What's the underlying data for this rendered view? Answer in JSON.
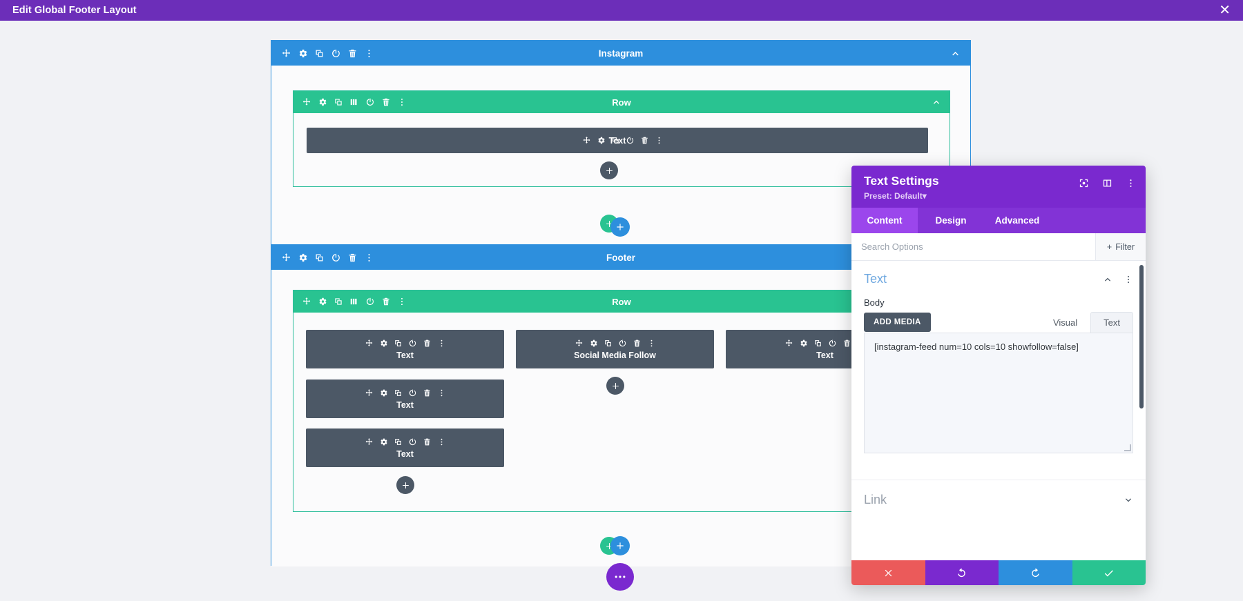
{
  "topbar": {
    "title": "Edit Global Footer Layout",
    "close_label": "✕"
  },
  "canvas": {
    "sections": [
      {
        "name": "Instagram",
        "title": "Instagram",
        "rows": [
          {
            "title": "Row",
            "modules": [
              {
                "label": "Text"
              }
            ]
          }
        ]
      },
      {
        "name": "Footer",
        "title": "Footer",
        "rows": [
          {
            "title": "Row",
            "columns": [
              {
                "modules": [
                  {
                    "label": "Text"
                  },
                  {
                    "label": "Text"
                  },
                  {
                    "label": "Text"
                  }
                ]
              },
              {
                "modules": [
                  {
                    "label": "Social Media Follow"
                  }
                ]
              },
              {
                "modules": [
                  {
                    "label": "Text"
                  }
                ]
              }
            ]
          }
        ]
      }
    ],
    "add_module_label": "+",
    "add_row_label": "+",
    "add_section_label": "+",
    "more_label": "•••"
  },
  "modal": {
    "title": "Text Settings",
    "preset": "Preset: Default",
    "preset_caret": "▾",
    "tabs": [
      {
        "label": "Content",
        "active": true
      },
      {
        "label": "Design",
        "active": false
      },
      {
        "label": "Advanced",
        "active": false
      }
    ],
    "search": {
      "placeholder": "Search Options",
      "value": ""
    },
    "filter_label": "Filter",
    "toggle": {
      "title": "Text",
      "field_label": "Body"
    },
    "editor": {
      "add_media_label": "ADD MEDIA",
      "tabs": [
        {
          "label": "Visual",
          "active": false
        },
        {
          "label": "Text",
          "active": true
        }
      ],
      "content": "[instagram-feed num=10 cols=10 showfollow=false]"
    },
    "link": {
      "title": "Link"
    },
    "footer_buttons": [
      {
        "name": "cancel"
      },
      {
        "name": "undo"
      },
      {
        "name": "redo"
      },
      {
        "name": "save"
      }
    ]
  },
  "colors": {
    "admin_purple": "#6c2eb9",
    "modal_purple": "#7a29cf",
    "section_blue": "#2d8fdd",
    "row_green": "#29c391",
    "module_grey": "#4c5866",
    "cancel_red": "#eb5a5a"
  }
}
